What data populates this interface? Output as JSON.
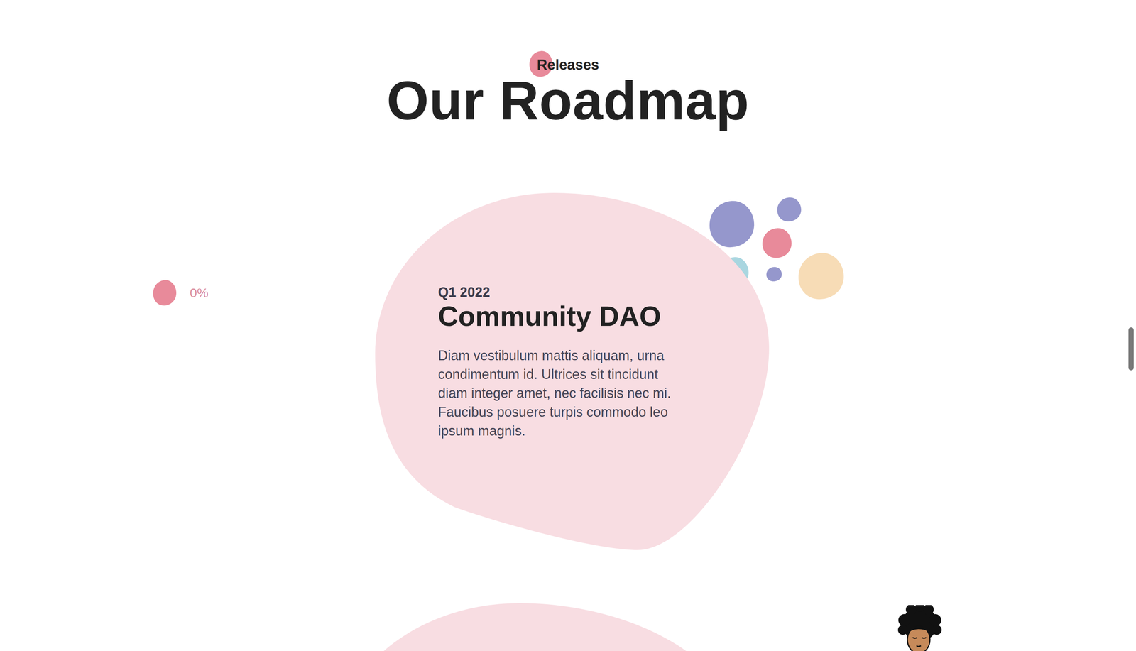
{
  "section": {
    "label": "Releases",
    "heading": "Our Roadmap"
  },
  "progress": {
    "reading": "0%"
  },
  "milestones": [
    {
      "quarter": "Q1 2022",
      "title": "Community DAO",
      "lines": [
        "Diam vestibulum mattis aliquam, urna",
        "condimentum id. Ultrices sit tincidunt",
        "diam integer amet, nec facilisis nec mi.",
        "Faucibus posuere turpis commodo leo",
        "ipsum magnis."
      ]
    }
  ]
}
